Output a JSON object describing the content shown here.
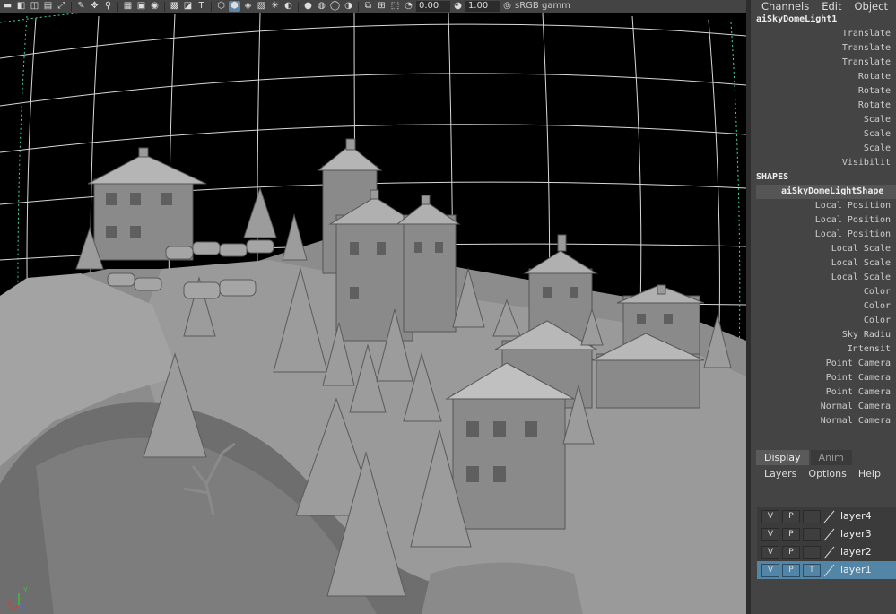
{
  "toolbar": {
    "field1": "0.00",
    "field2": "1.00",
    "color_space": "sRGB gamm"
  },
  "channel_box": {
    "menu": [
      "Channels",
      "Edit",
      "Object"
    ],
    "node_name": "aiSkyDomeLight1",
    "transform_attrs": [
      "Translate",
      "Translate",
      "Translate",
      "Rotate",
      "Rotate",
      "Rotate",
      "Scale",
      "Scale",
      "Scale",
      "Visibilit"
    ],
    "shapes_header": "SHAPES",
    "shape_name": "aiSkyDomeLightShape",
    "shape_attrs": [
      "Local Position",
      "Local Position",
      "Local Position",
      "Local Scale",
      "Local Scale",
      "Local Scale",
      "Color",
      "Color",
      "Color",
      "Sky Radiu",
      "Intensit",
      "Point Camera",
      "Point Camera",
      "Point Camera",
      "Normal Camera",
      "Normal Camera"
    ]
  },
  "layer_editor": {
    "tabs": [
      "Display",
      "Anim"
    ],
    "menu": [
      "Layers",
      "Options",
      "Help"
    ],
    "layers": [
      {
        "name": "layer4",
        "v": "V",
        "p": "P",
        "t": ""
      },
      {
        "name": "layer3",
        "v": "V",
        "p": "P",
        "t": ""
      },
      {
        "name": "layer2",
        "v": "V",
        "p": "P",
        "t": ""
      },
      {
        "name": "layer1",
        "v": "V",
        "p": "P",
        "t": "T"
      }
    ]
  },
  "viewport": {
    "axis_y": "Y",
    "axis_x": "X"
  },
  "colors": {
    "accent": "#5285a6",
    "grid": "#d8d8d8",
    "grid_dotted": "#3fd8a8"
  }
}
